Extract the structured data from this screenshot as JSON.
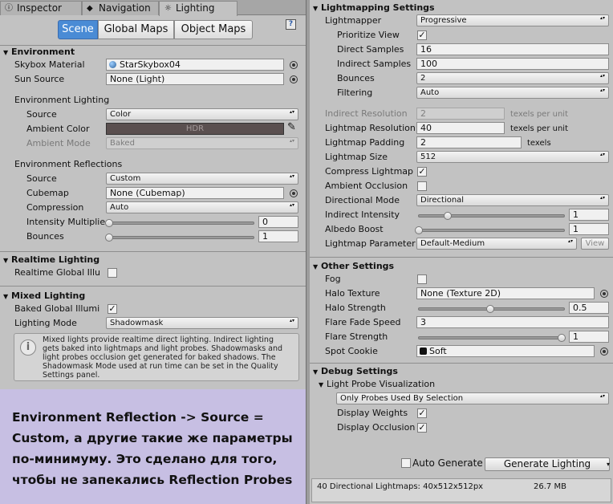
{
  "tabs": [
    {
      "label": "Inspector",
      "icon": "info-icon"
    },
    {
      "label": "Navigation",
      "icon": "navigation-icon"
    },
    {
      "label": "Lighting",
      "icon": "lighting-icon"
    }
  ],
  "scene_tabs": [
    "Scene",
    "Global Maps",
    "Object Maps"
  ],
  "environment": {
    "header": "Environment",
    "skybox_label": "Skybox Material",
    "skybox_value": "StarSkybox04",
    "sun_label": "Sun Source",
    "sun_value": "None (Light)",
    "lighting_header": "Environment Lighting",
    "source_label": "Source",
    "source_value": "Color",
    "ambient_color_label": "Ambient Color",
    "ambient_color_text": "HDR",
    "ambient_color": "#5a4f4f",
    "ambient_mode_label": "Ambient Mode",
    "ambient_mode_value": "Baked",
    "reflections_header": "Environment Reflections",
    "refl_source_label": "Source",
    "refl_source_value": "Custom",
    "cubemap_label": "Cubemap",
    "cubemap_value": "None (Cubemap)",
    "compression_label": "Compression",
    "compression_value": "Auto",
    "intensity_label": "Intensity Multiplie",
    "intensity_value": "0",
    "bounces_label": "Bounces",
    "bounces_value": "1"
  },
  "realtime": {
    "header": "Realtime Lighting",
    "gi_label": "Realtime Global Illu"
  },
  "mixed": {
    "header": "Mixed Lighting",
    "baked_label": "Baked Global Illumi",
    "mode_label": "Lighting Mode",
    "mode_value": "Shadowmask",
    "info_lines": [
      "Mixed lights provide realtime direct lighting. Indirect lighting",
      "gets baked into lightmaps and light probes. Shadowmasks and",
      "light probes occlusion get generated for baked shadows. The",
      "Shadowmask Mode used at run time can be set in the Quality",
      "Settings panel."
    ]
  },
  "annotation": {
    "lines": [
      "Environment Reflection -> Source =",
      "Custom, а другие такие же параметры",
      "по-минимуму. Это сделано для того,",
      "чтобы не запекались Reflection Probes"
    ],
    "bg": "#c7bfe3"
  },
  "lightmapping": {
    "header": "Lightmapping Settings",
    "lightmapper_label": "Lightmapper",
    "lightmapper_value": "Progressive",
    "prioritize_label": "Prioritize View",
    "direct_label": "Direct Samples",
    "direct_value": "16",
    "indirect_label": "Indirect Samples",
    "indirect_value": "100",
    "bounces_label": "Bounces",
    "bounces_value": "2",
    "filtering_label": "Filtering",
    "filtering_value": "Auto",
    "ind_res_label": "Indirect Resolution",
    "ind_res_value": "2",
    "ind_res_unit": "texels per unit",
    "lm_res_label": "Lightmap Resolution",
    "lm_res_value": "40",
    "lm_res_unit": "texels per unit",
    "padding_label": "Lightmap Padding",
    "padding_value": "2",
    "padding_unit": "texels",
    "size_label": "Lightmap Size",
    "size_value": "512",
    "compress_label": "Compress Lightmap",
    "ao_label": "Ambient Occlusion",
    "dir_mode_label": "Directional Mode",
    "dir_mode_value": "Directional",
    "ind_int_label": "Indirect Intensity",
    "ind_int_value": "1",
    "albedo_label": "Albedo Boost",
    "albedo_value": "1",
    "params_label": "Lightmap Parameter",
    "params_value": "Default-Medium",
    "view_label": "View"
  },
  "other": {
    "header": "Other Settings",
    "fog_label": "Fog",
    "halo_tex_label": "Halo Texture",
    "halo_tex_value": "None (Texture 2D)",
    "halo_str_label": "Halo Strength",
    "halo_str_value": "0.5",
    "flare_fade_label": "Flare Fade Speed",
    "flare_fade_value": "3",
    "flare_str_label": "Flare Strength",
    "flare_str_value": "1",
    "cookie_label": "Spot Cookie",
    "cookie_value": "Soft"
  },
  "debug": {
    "header": "Debug Settings",
    "probe_vis_label": "Light Probe Visualization",
    "probe_vis_value": "Only Probes Used By Selection",
    "weights_label": "Display Weights",
    "occlusion_label": "Display Occlusion"
  },
  "footer": {
    "auto_label": "Auto Generate",
    "generate_label": "Generate Lighting",
    "status_text": "40 Directional Lightmaps: 40x512x512px",
    "size_text": "26.7 MB"
  }
}
